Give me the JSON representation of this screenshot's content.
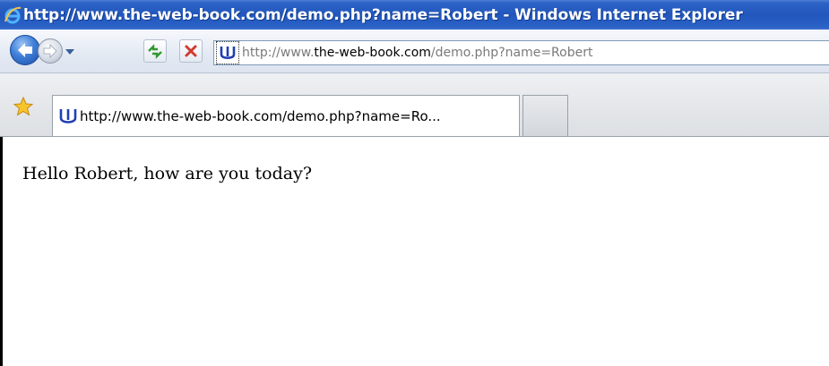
{
  "window": {
    "title": "http://www.the-web-book.com/demo.php?name=Robert - Windows Internet Explorer"
  },
  "icons": {
    "app": "internet-explorer-logo-icon",
    "back": "back-arrow-icon",
    "forward": "forward-arrow-icon",
    "history": "chevron-down-icon",
    "refresh": "refresh-icon",
    "stop": "stop-icon",
    "site": "site-favicon-icon",
    "favorites": "favorites-star-icon"
  },
  "address_bar": {
    "url_prefix": "http://www.",
    "url_domain": "the-web-book.com",
    "url_path": "/demo.php?name=Robert"
  },
  "tabs": [
    {
      "label": "http://www.the-web-book.com/demo.php?name=Ro..."
    }
  ],
  "page": {
    "greeting": "Hello Robert, how are you today?"
  },
  "colors": {
    "titlebar": "#2256bd",
    "title_text": "#ffffff",
    "stop_red": "#d13b2f",
    "refresh_green": "#2f9a2f",
    "site_icon_blue": "#1f3fb3"
  }
}
